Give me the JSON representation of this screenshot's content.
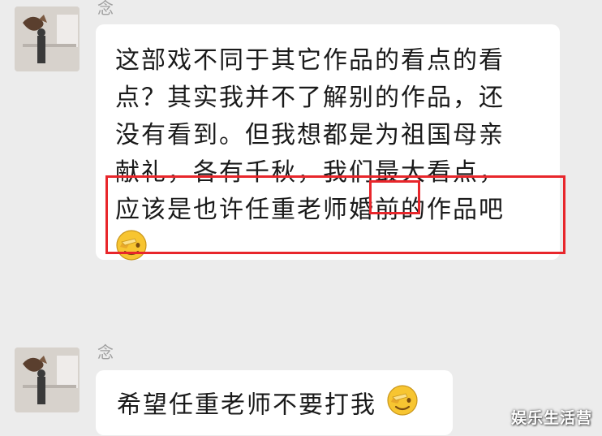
{
  "messages": [
    {
      "sender": "念",
      "lines": [
        "这部戏不同于其它作品的看点的看",
        "点？其实我并不了解别的作品，还",
        "没有看到。但我想都是为祖国母亲",
        "献礼，各有千秋，我们最大看点，"
      ],
      "highlight_prefix": "应该是也许任重老师",
      "highlight_word": "婚前",
      "highlight_suffix": "的作品吧",
      "emoji": "facepalm-laugh-emoji"
    },
    {
      "sender": "念",
      "text": "希望任重老师不要打我",
      "emoji": "facepalm-laugh-emoji"
    }
  ],
  "watermark": "娱乐生活营",
  "colors": {
    "background": "#ececec",
    "bubble": "#ffffff",
    "highlight_box": "#e8262b",
    "sender_name": "#a0a0a0"
  }
}
